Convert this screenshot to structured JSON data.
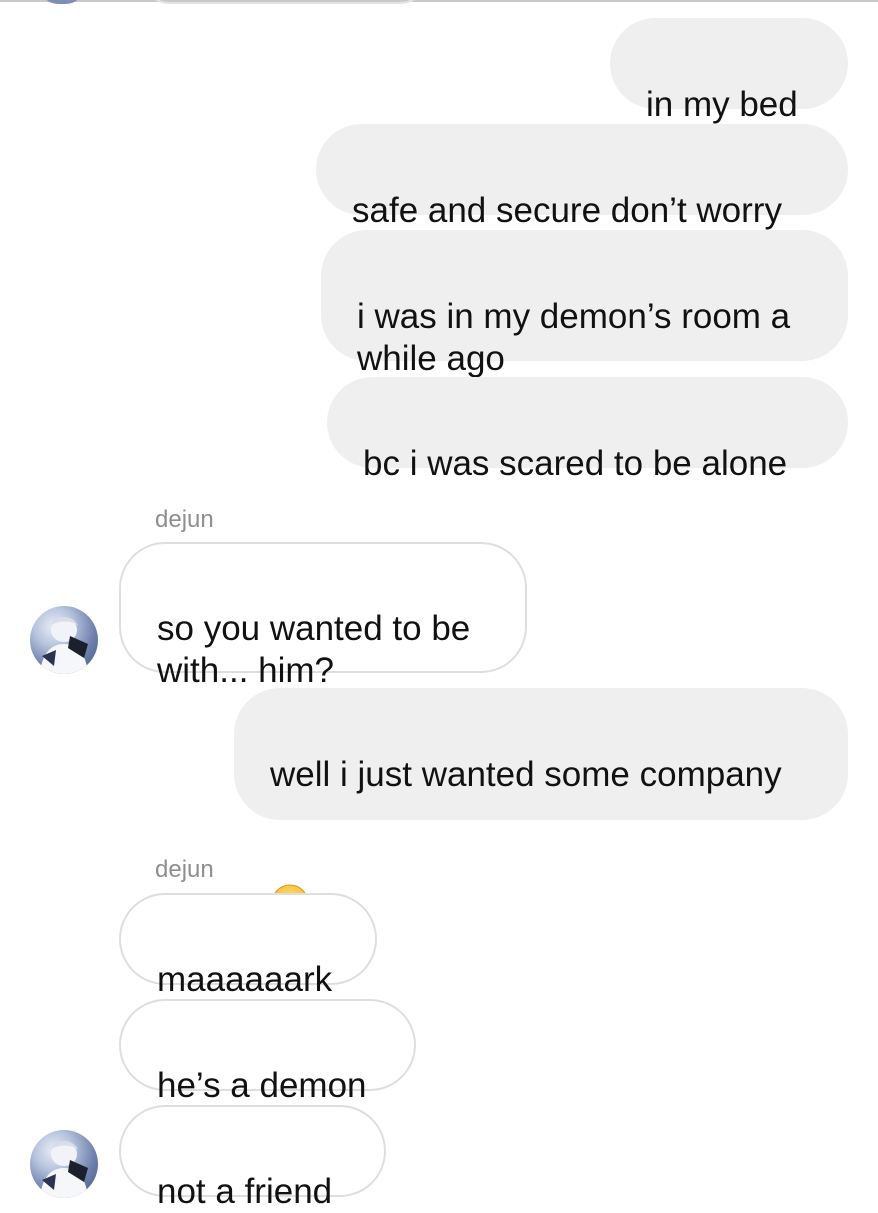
{
  "messages": [
    {
      "direction": "out",
      "text": "in my bed"
    },
    {
      "direction": "out",
      "text": "safe and secure don’t worry"
    },
    {
      "direction": "out",
      "text": "i was in my demon’s room a\nwhile ago"
    },
    {
      "direction": "out",
      "text": "bc i was scared to be alone"
    },
    {
      "direction": "in",
      "sender": "dejun",
      "text": "so you wanted to be\nwith... him?"
    },
    {
      "direction": "out",
      "text": "well i just wanted some company",
      "emoji": "confused-face-icon"
    },
    {
      "direction": "in",
      "sender": "dejun",
      "text": "maaaaaark"
    },
    {
      "direction": "in",
      "text": "he’s a demon"
    },
    {
      "direction": "in",
      "text": "not a friend"
    }
  ],
  "colors": {
    "outgoing_bubble": "#efefef",
    "incoming_border": "#dedede",
    "sender_label": "#8e8e8e",
    "text": "#111111"
  },
  "icons": {
    "avatar": "avatar-photo-icon",
    "emoji": "confused-face-icon"
  }
}
